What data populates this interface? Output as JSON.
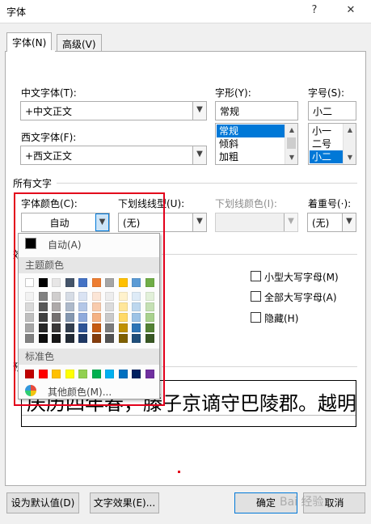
{
  "window": {
    "title": "字体",
    "help_label": "?",
    "close_label": "✕"
  },
  "tabs": [
    {
      "label": "字体(N)",
      "active": true
    },
    {
      "label": "高级(V)",
      "active": false
    }
  ],
  "font": {
    "chinese_font_label": "中文字体(T):",
    "chinese_font_value": "+中文正文",
    "western_font_label": "西文字体(F):",
    "western_font_value": "+西文正文",
    "style_label": "字形(Y):",
    "style_value": "常规",
    "style_options": [
      "常规",
      "倾斜",
      "加粗"
    ],
    "style_selected_index": 0,
    "size_label": "字号(S):",
    "size_value": "小二",
    "size_options": [
      "小一",
      "二号",
      "小二"
    ],
    "size_selected_index": 2
  },
  "all_text": {
    "section_label": "所有文字",
    "font_color_label": "字体颜色(C):",
    "font_color_value": "自动",
    "underline_label": "下划线线型(U):",
    "underline_value": "(无)",
    "underline_color_label": "下划线颜色(I):",
    "emphasis_label": "着重号(·):",
    "emphasis_value": "(无)"
  },
  "effects": {
    "section_label": "效",
    "small_caps_label": "小型大写字母(M)",
    "all_caps_label": "全部大写字母(A)",
    "hidden_label": "隐藏(H)"
  },
  "preview": {
    "section_label": "预",
    "sample_text": "庆历四年春，滕子京谪守巴陵郡。越明年"
  },
  "color_popup": {
    "auto_label": "自动(A)",
    "theme_header": "主题颜色",
    "theme_top_row": [
      "#ffffff",
      "#000000",
      "#e7e6e6",
      "#44546a",
      "#4472c4",
      "#ed7d31",
      "#a5a5a5",
      "#ffc000",
      "#5b9bd5",
      "#70ad47"
    ],
    "theme_shades": [
      [
        "#f2f2f2",
        "#d9d9d9",
        "#bfbfbf",
        "#a6a6a6",
        "#808080"
      ],
      [
        "#808080",
        "#595959",
        "#404040",
        "#262626",
        "#0d0d0d"
      ],
      [
        "#d0cece",
        "#aeaaaa",
        "#757171",
        "#3a3838",
        "#171616"
      ],
      [
        "#d6dce5",
        "#adb9ca",
        "#8497b0",
        "#333f50",
        "#222a35"
      ],
      [
        "#dae3f3",
        "#b4c7e7",
        "#8faadc",
        "#2f5597",
        "#1f3864"
      ],
      [
        "#fbe5d6",
        "#f8cbad",
        "#f4b183",
        "#c55a11",
        "#843c0c"
      ],
      [
        "#ededed",
        "#dbdbdb",
        "#c9c9c9",
        "#7b7b7b",
        "#525252"
      ],
      [
        "#fff2cc",
        "#ffe699",
        "#ffd966",
        "#bf9000",
        "#7f6000"
      ],
      [
        "#deebf7",
        "#bdd7ee",
        "#9dc3e6",
        "#2e75b6",
        "#1f4e79"
      ],
      [
        "#e2f0d9",
        "#c5e0b4",
        "#a9d18e",
        "#548235",
        "#385723"
      ]
    ],
    "standard_header": "标准色",
    "standard_colors": [
      "#c00000",
      "#ff0000",
      "#ffc000",
      "#ffff00",
      "#92d050",
      "#00b050",
      "#00b0f0",
      "#0070c0",
      "#002060",
      "#7030a0"
    ],
    "more_colors_label": "其他颜色(M)..."
  },
  "buttons": {
    "set_default": "设为默认值(D)",
    "text_effects": "文字效果(E)...",
    "ok": "确定",
    "cancel": "取消"
  },
  "colors": {
    "annotation_red": "#e3001b",
    "accent_blue": "#0078d7"
  },
  "watermark": "Bai 经验"
}
